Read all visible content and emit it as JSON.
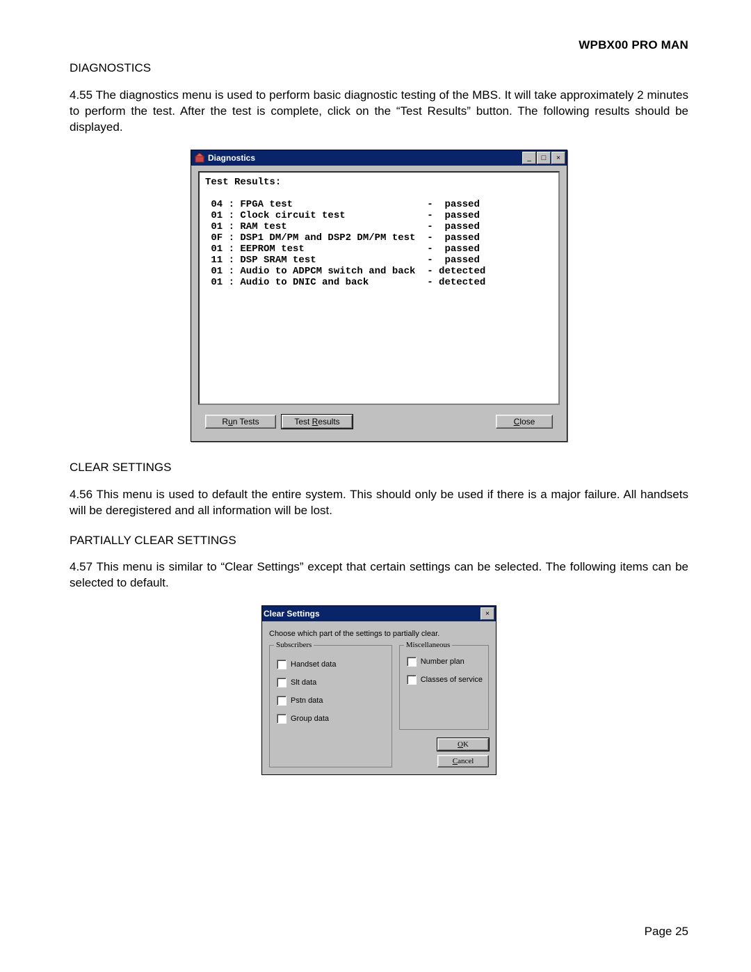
{
  "page": {
    "header_right": "WPBX00 PRO MAN",
    "footer": "Page 25"
  },
  "sections": {
    "diagnostics_label": "DIAGNOSTICS",
    "diagnostics_para": "4.55    The diagnostics menu is used to perform basic diagnostic testing of the MBS.  It will take approximately 2 minutes to perform the test.  After the test is complete, click on the “Test Results” button.  The following results should be displayed.",
    "clear_label": "CLEAR SETTINGS",
    "clear_para": "4.56    This menu is used to default the entire system.  This should only be used if there is a major failure.  All handsets will be deregistered and all information will be lost.",
    "partial_label": "PARTIALLY CLEAR SETTINGS",
    "partial_para": "4.57    This menu is  similar to “Clear Settings” except that certain settings can be selected.  The following items can be selected to default."
  },
  "diag_window": {
    "title": "Diagnostics",
    "results_text": "Test Results:\n\n 04 : FPGA test                       -  passed\n 01 : Clock circuit test              -  passed\n 01 : RAM test                        -  passed\n 0F : DSP1 DM/PM and DSP2 DM/PM test  -  passed\n 01 : EEPROM test                     -  passed\n 11 : DSP SRAM test                   -  passed\n 01 : Audio to ADPCM switch and back  - detected\n 01 : Audio to DNIC and back          - detected",
    "buttons": {
      "run_tests_pre": "R",
      "run_tests_u": "u",
      "run_tests_post": "n Tests",
      "test_results_pre": "Test ",
      "test_results_u": "R",
      "test_results_post": "esults",
      "close_u": "C",
      "close_post": "lose"
    }
  },
  "cs_window": {
    "title": "Clear Settings",
    "instruction": "Choose which part of the settings to partially clear.",
    "subscribers_legend": "Subscribers",
    "misc_legend": "Miscellaneous",
    "subscribers": {
      "handset": "Handset data",
      "slt": "Slt data",
      "pstn": "Pstn data",
      "group": "Group data"
    },
    "misc": {
      "number_plan": "Number plan",
      "cos": "Classes of service"
    },
    "buttons": {
      "ok_u": "O",
      "ok_post": "K",
      "cancel_u": "C",
      "cancel_post": "ancel"
    }
  }
}
